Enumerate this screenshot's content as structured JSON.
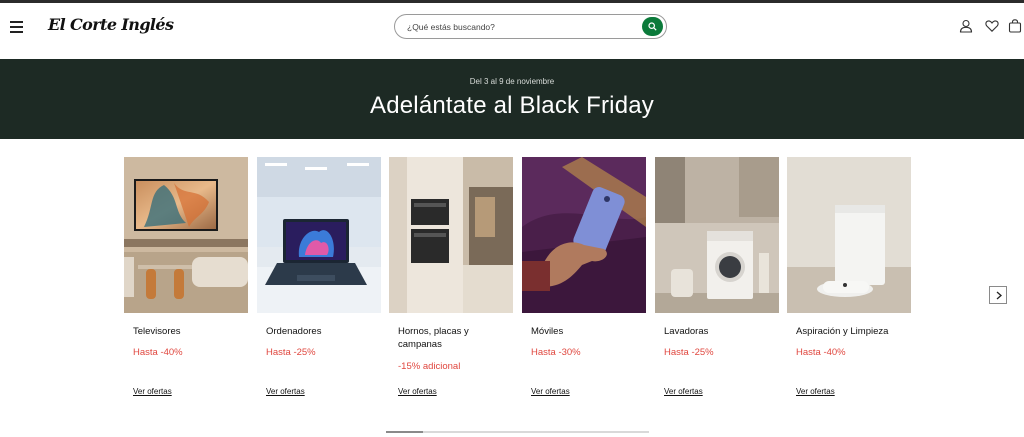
{
  "header": {
    "logo_text": "El Corte Inglés",
    "search": {
      "placeholder": "¿Qué estás buscando?",
      "value": ""
    },
    "icons": [
      "menu-icon",
      "search-icon",
      "user-icon",
      "heart-icon",
      "bag-icon"
    ],
    "accent_color": "#0b7a3a"
  },
  "banner": {
    "subtitle": "Del 3 al 9 de noviembre",
    "title": "Adelántate al Black Friday",
    "background": "#1d2a24"
  },
  "categories": [
    {
      "name": "Televisores",
      "offer": "Hasta -40%",
      "link": "Ver ofertas"
    },
    {
      "name": "Ordenadores",
      "offer": "Hasta -25%",
      "link": "Ver ofertas"
    },
    {
      "name": "Hornos, placas y campanas",
      "offer": "-15% adicional",
      "link": "Ver ofertas"
    },
    {
      "name": "Móviles",
      "offer": "Hasta -30%",
      "link": "Ver ofertas"
    },
    {
      "name": "Lavadoras",
      "offer": "Hasta -25%",
      "link": "Ver ofertas"
    },
    {
      "name": "Aspiración y Limpieza",
      "offer": "Hasta -40%",
      "link": "Ver ofertas"
    }
  ],
  "offer_color": "#e0473f",
  "carousel": {
    "next_icon": "chevron-right-icon",
    "progress": 0.14
  }
}
